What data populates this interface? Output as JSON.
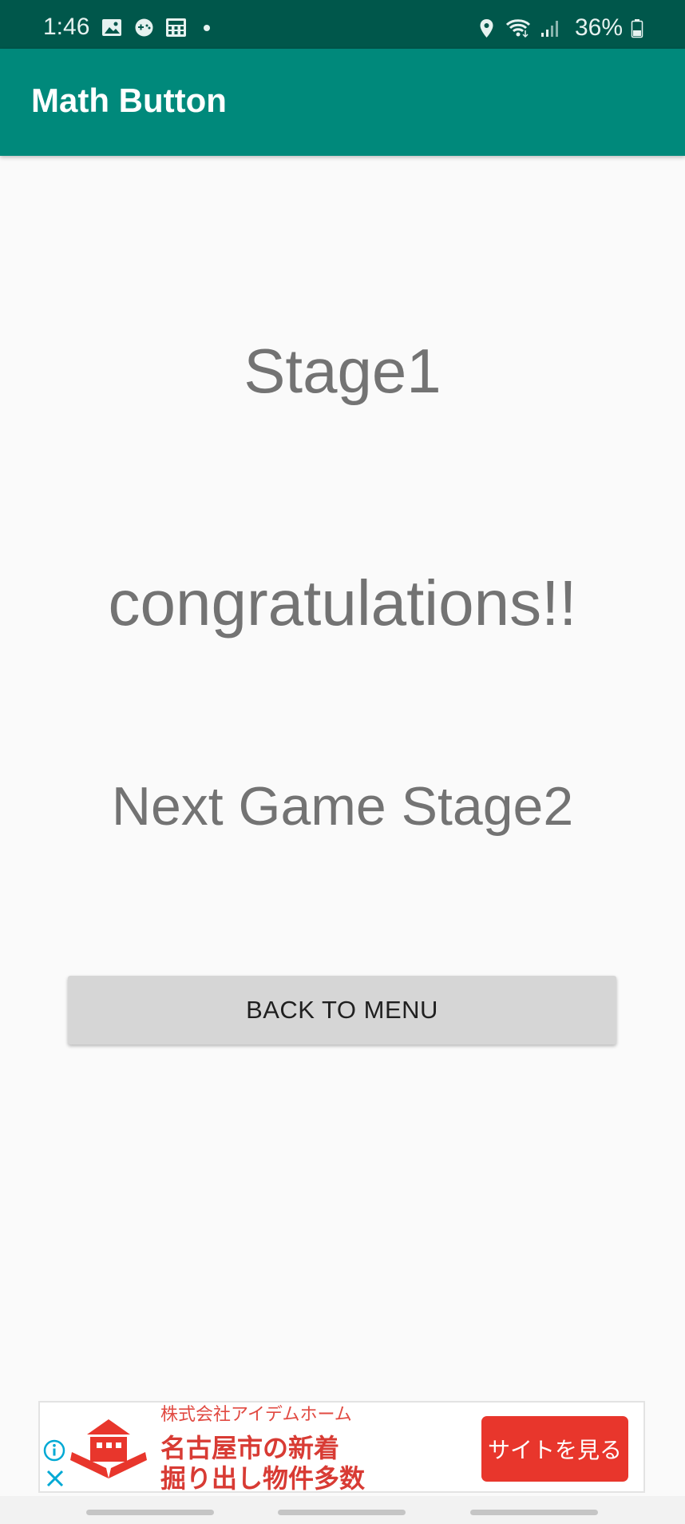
{
  "status_bar": {
    "time": "1:46",
    "battery": "36%",
    "left_icons": [
      "image-icon",
      "game-controller-icon",
      "calculator-icon",
      "notification-dot"
    ],
    "right_icons": [
      "location-icon",
      "wifi-icon",
      "signal-icon",
      "battery-icon"
    ]
  },
  "app_bar": {
    "title": "Math Button",
    "background_color": "#00897b"
  },
  "main": {
    "stage": "Stage1",
    "congratulations": "congratulations!!",
    "next_game": "Next Game Stage2",
    "back_button_label": "BACK TO MENU"
  },
  "ad": {
    "company": "株式会社アイデムホーム",
    "headline": "名古屋市の新着\n掘り出し物件多数",
    "cta_label": "サイトを見る",
    "accent_color": "#e8362c"
  }
}
